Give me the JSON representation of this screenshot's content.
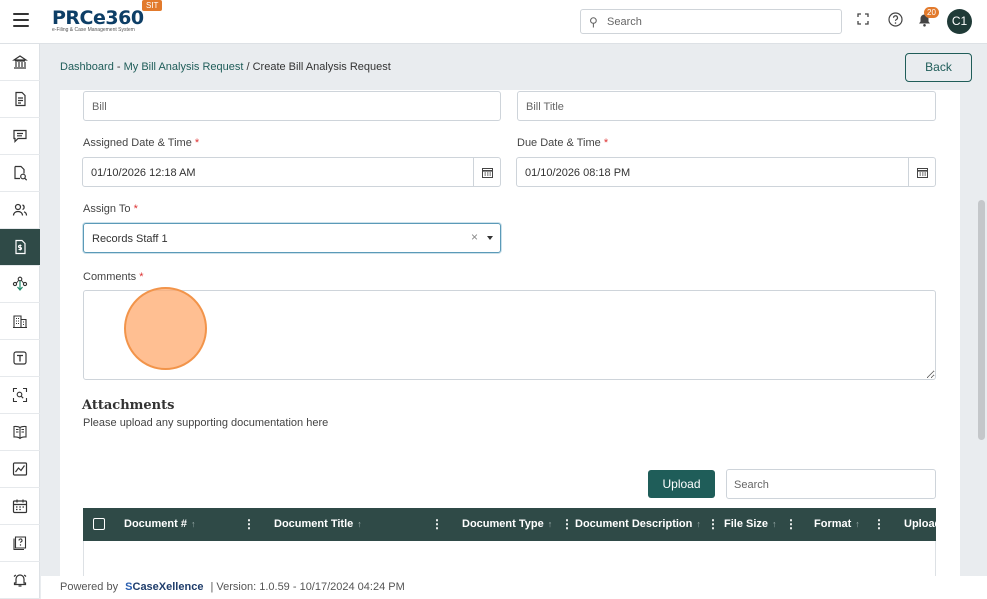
{
  "header": {
    "logo_main": "PRCe360",
    "logo_sub": "e-Filing & Case Management System",
    "env_badge": "SIT",
    "search_placeholder": "Search",
    "notification_count": "20",
    "avatar_initials": "C1"
  },
  "sidebar": {
    "items": [
      {
        "icon": "bank-icon"
      },
      {
        "icon": "document-icon"
      },
      {
        "icon": "comment-icon"
      },
      {
        "icon": "document-search-icon"
      },
      {
        "icon": "users-icon"
      },
      {
        "icon": "bill-dollar-icon",
        "active": true
      },
      {
        "icon": "hierarchy-icon"
      },
      {
        "icon": "building-icon"
      },
      {
        "icon": "text-box-icon"
      },
      {
        "icon": "scan-search-icon"
      },
      {
        "icon": "book-icon"
      },
      {
        "icon": "chart-icon"
      },
      {
        "icon": "calendar-icon"
      },
      {
        "icon": "help-book-icon"
      },
      {
        "icon": "alarm-icon"
      }
    ]
  },
  "breadcrumb": {
    "link1": "Dashboard",
    "sep1": " - ",
    "link2": "My Bill Analysis Request",
    "sep2": " / ",
    "current": "Create Bill Analysis Request"
  },
  "back_label": "Back",
  "form": {
    "bill_placeholder": "Bill",
    "bill_title_placeholder": "Bill Title",
    "assigned_label": "Assigned Date & Time",
    "assigned_value": "01/10/2026 12:18 AM",
    "due_label": "Due Date & Time",
    "due_value": "01/10/2026 08:18 PM",
    "assign_to_label": "Assign To",
    "assign_to_value": "Records Staff 1",
    "comments_label": "Comments",
    "required_mark": "*"
  },
  "attachments": {
    "title": "Attachments",
    "subtitle": "Please upload any supporting documentation here",
    "upload_label": "Upload",
    "search_placeholder": "Search",
    "columns": [
      "Document #",
      "Document Title",
      "Document Type",
      "Document Description",
      "File Size",
      "Format",
      "Upload"
    ]
  },
  "footer": {
    "powered_by": "Powered by",
    "brand": "CaseXellence",
    "version": "|  Version: 1.0.59 - 10/17/2024 04:24 PM"
  },
  "colors": {
    "primary": "#1f5d59",
    "sidebar_active": "#2f4a47",
    "accent_orange": "#e27a2c"
  }
}
